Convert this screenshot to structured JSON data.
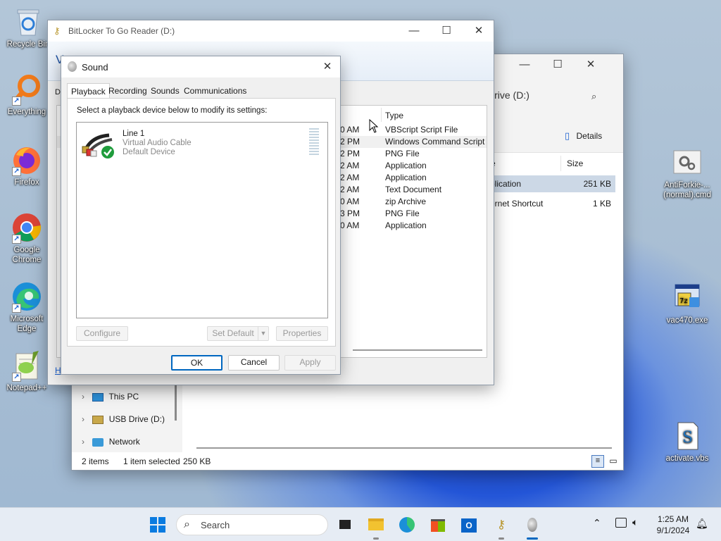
{
  "desktop_icons": [
    {
      "label": "Recycle Bin"
    },
    {
      "label": "Everything"
    },
    {
      "label": "Firefox"
    },
    {
      "label": "Google Chrome"
    },
    {
      "label": "Microsoft Edge"
    },
    {
      "label": "Notepad++"
    },
    {
      "label": "AntiForkie-...(normal).cmd"
    },
    {
      "label": "vac470.exe"
    },
    {
      "label": "activate.vbs"
    }
  ],
  "bitlocker": {
    "title": "BitLocker To Go Reader (D:)",
    "v_letter": "V",
    "d_letter": "D"
  },
  "explorer": {
    "search_hint": "Drive (D:)",
    "details_label": "Details",
    "columns": {
      "name": "e",
      "size": "Size"
    },
    "files": [
      {
        "name": "plication",
        "size": "251 KB"
      },
      {
        "name": "ernet Shortcut",
        "size": "1 KB"
      }
    ],
    "nav": [
      {
        "label": "This PC"
      },
      {
        "label": "USB Drive (D:)"
      },
      {
        "label": "Network"
      }
    ],
    "status": {
      "items": "2 items",
      "selected": "1 item selected",
      "size": "250 KB"
    }
  },
  "bitlocker_list": {
    "type_header": "Type",
    "rows": [
      {
        "time": "0 AM",
        "type": "VBScript Script File"
      },
      {
        "time": "2 PM",
        "type": "Windows Command Script"
      },
      {
        "time": "2 PM",
        "type": "PNG File"
      },
      {
        "time": "2 AM",
        "type": "Application"
      },
      {
        "time": "2 AM",
        "type": "Application"
      },
      {
        "time": "2 AM",
        "type": "Text Document"
      },
      {
        "time": "0 AM",
        "type": "zip Archive"
      },
      {
        "time": "3 PM",
        "type": "PNG File"
      },
      {
        "time": "0 AM",
        "type": "Application"
      }
    ],
    "help_letter": "H"
  },
  "sound": {
    "title": "Sound",
    "tabs": [
      "Playback",
      "Recording",
      "Sounds",
      "Communications"
    ],
    "instruction": "Select a playback device below to modify its settings:",
    "device": {
      "name": "Line 1",
      "desc": "Virtual Audio Cable",
      "status": "Default Device"
    },
    "buttons": {
      "configure": "Configure",
      "set_default": "Set Default",
      "properties": "Properties",
      "ok": "OK",
      "cancel": "Cancel",
      "apply": "Apply"
    }
  },
  "taskbar": {
    "search_placeholder": "Search",
    "time": "1:25 AM",
    "date": "9/1/2024"
  },
  "colors": {
    "accent": "#0067c0",
    "green_check": "#1f9c3c"
  }
}
